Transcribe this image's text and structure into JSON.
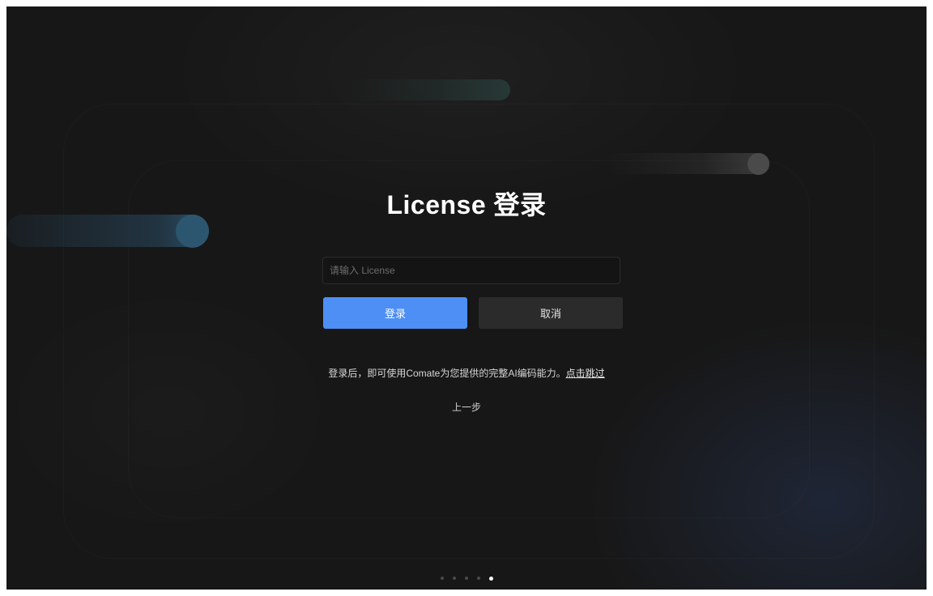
{
  "title": "License 登录",
  "license_input": {
    "placeholder": "请输入 License",
    "value": ""
  },
  "buttons": {
    "login_label": "登录",
    "cancel_label": "取消"
  },
  "hint": {
    "text": "登录后，即可使用Comate为您提供的完整AI编码能力。",
    "skip_link": "点击跳过"
  },
  "prev_step_label": "上一步",
  "pagination": {
    "total": 5,
    "current": 5
  },
  "colors": {
    "background": "#171717",
    "primary_button": "#4d8ff4",
    "secondary_button": "#2b2b2b"
  }
}
